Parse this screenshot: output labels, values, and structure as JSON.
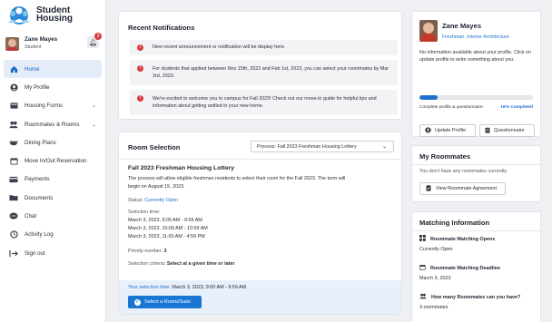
{
  "app": {
    "logo_line1": "Student",
    "logo_line2": "Housing"
  },
  "user": {
    "name": "Zane Mayes",
    "role": "Student",
    "notification_count": "3"
  },
  "nav": [
    {
      "label": "Home",
      "icon": "home-icon",
      "active": true
    },
    {
      "label": "My Profile",
      "icon": "profile-icon"
    },
    {
      "label": "Housing Forms",
      "icon": "forms-icon",
      "expandable": true
    },
    {
      "label": "Roommates & Rooms",
      "icon": "roommates-icon",
      "expandable": true
    },
    {
      "label": "Dining Plans",
      "icon": "dining-icon"
    },
    {
      "label": "Move In/Out Reservation",
      "icon": "calendar-icon"
    },
    {
      "label": "Payments",
      "icon": "payments-icon"
    },
    {
      "label": "Documents",
      "icon": "folder-icon"
    },
    {
      "label": "Chat",
      "icon": "chat-icon"
    },
    {
      "label": "Activity Log",
      "icon": "activity-icon"
    },
    {
      "label": "Sign out",
      "icon": "signout-icon"
    }
  ],
  "notifications": {
    "title": "Recent Notifications",
    "items": [
      {
        "text": "New recent announcement or notification will be display here."
      },
      {
        "text": "For students that applied between Nov 15th, 2022 and Feb 1st, 2023, you can select your roommates by Mar 3rd, 2023."
      },
      {
        "text": "We're excited to welcome you to campus for Fall 2023! Check out our move-in guide for helpful tips and information about getting settled in your new home."
      }
    ]
  },
  "room_selection": {
    "title": "Room Selection",
    "process_label": "Process:",
    "process_value": "Fall 2023 Freshman Housing Lottery",
    "lottery_title": "Fall 2023 Freshman Housing Lottery",
    "description_line1": "The process will allow eligible freshman residents to select their room for the Fall 2023. The term will",
    "description_line2": "begin on August 15, 2023.",
    "status_label": "Status:",
    "status_value": "Currently Open",
    "selection_time_label": "Selection time:",
    "selection_times": [
      "March 3, 2023, 9:00 AM - 9:59 AM",
      "March 3, 2023, 10:00 AM - 10:59 AM",
      "March 3, 2023, 11:00 AM - 4:59 PM"
    ],
    "priority_label": "Priority number:",
    "priority_value": "3",
    "criteria_label": "Selection criteria:",
    "criteria_value": "Select at a given time or later",
    "your_time_label": "Your selection time:",
    "your_time_value": "March 3, 2023, 9:00 AM - 9:59 AM",
    "select_button": "Select a Room/Suite"
  },
  "profile": {
    "name": "Zane Mayes",
    "subtitle": "Freshman, Interior Architecture",
    "description": "No information available about your profile. Click on update profile to write something about you.",
    "progress_label": "Complete profile & questionnaire:",
    "progress_percent_text": "16% Completed",
    "progress_value": 0.16,
    "update_button": "Update Profile",
    "questionnaire_button": "Questionnaire"
  },
  "roommates": {
    "title": "My Roommates",
    "empty_text": "You don't have any roommates currently.",
    "agreement_button": "View Roommate Agreement"
  },
  "matching": {
    "title": "Matching Information",
    "items": [
      {
        "label": "Roommate Matching Opens",
        "value": "Currently Open",
        "icon": "grid-icon"
      },
      {
        "label": "Roommate Matching Deadline",
        "value": "March 3, 2023",
        "icon": "calendar-icon"
      },
      {
        "label": "How many Roommates can you have?",
        "value": "3 roommates",
        "icon": "people-icon"
      }
    ]
  },
  "colors": {
    "accent": "#1976d2",
    "link": "#1e6fd0",
    "badge": "#dc3b3b",
    "active_nav_bg": "#e3ecf8"
  }
}
